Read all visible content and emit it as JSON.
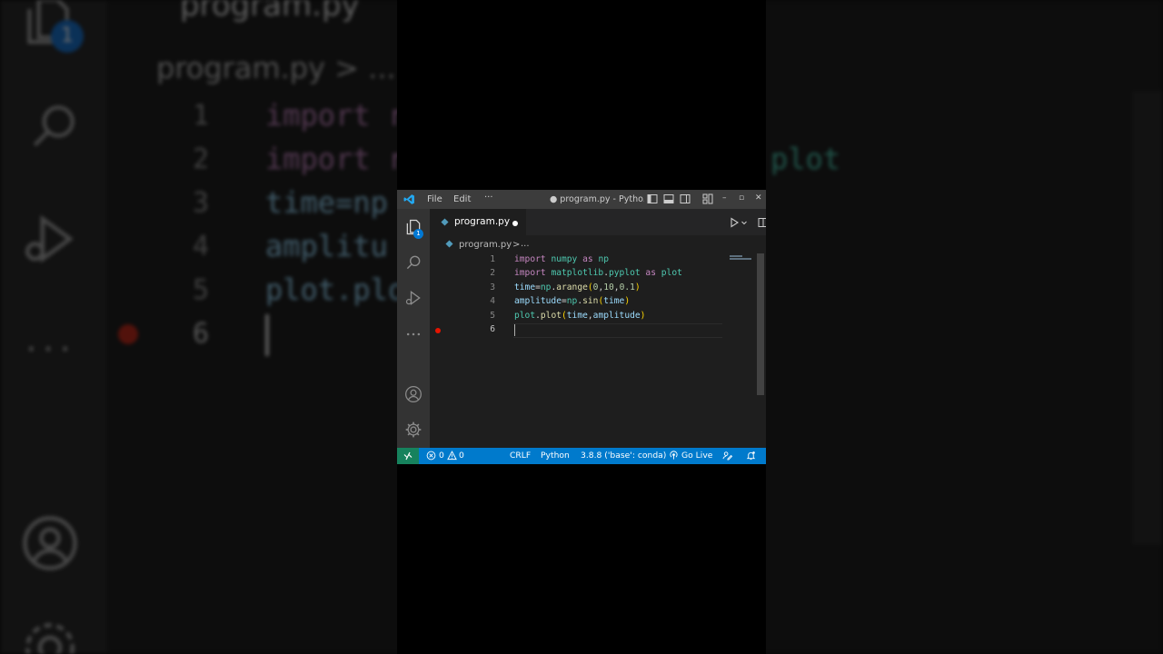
{
  "window": {
    "title": "● program.py - Pytho...",
    "menu": [
      "File",
      "Edit",
      "···"
    ]
  },
  "activity_bar": {
    "explorer_badge": "1"
  },
  "tab": {
    "label": "program.py",
    "language_icon": "python-icon"
  },
  "breadcrumb": {
    "file": "program.py",
    "separator": ">",
    "more": "..."
  },
  "editor": {
    "lines": [
      {
        "number": "1",
        "text": "import numpy as np"
      },
      {
        "number": "2",
        "text": "import matplotlib.pyplot as plot"
      },
      {
        "number": "3",
        "text": "time=np.arange(0,10,0.1)"
      },
      {
        "number": "4",
        "text": "amplitude=np.sin(time)"
      },
      {
        "number": "5",
        "text": "plot.plot(time,amplitude)"
      },
      {
        "number": "6",
        "text": ""
      }
    ],
    "current_line": 6,
    "breakpoint_line": 6
  },
  "status_bar": {
    "errors": "0",
    "warnings": "0",
    "line_ending": "CRLF",
    "language": "Python",
    "interpreter": "3.8.8 ('base': conda)",
    "go_live": "Go Live"
  },
  "background": {
    "tab": "program.py",
    "crumb": "program.py > ...",
    "badge": "1",
    "code_fragments": [
      "import r",
      "import r",
      "time=np",
      "amplitu",
      "plot.plo",
      "plot"
    ],
    "line_numbers": [
      "1",
      "2",
      "3",
      "4",
      "5",
      "6"
    ],
    "dots": "···"
  },
  "colors": {
    "accent": "#007acc",
    "remote": "#16825d",
    "breakpoint": "#e51400"
  }
}
